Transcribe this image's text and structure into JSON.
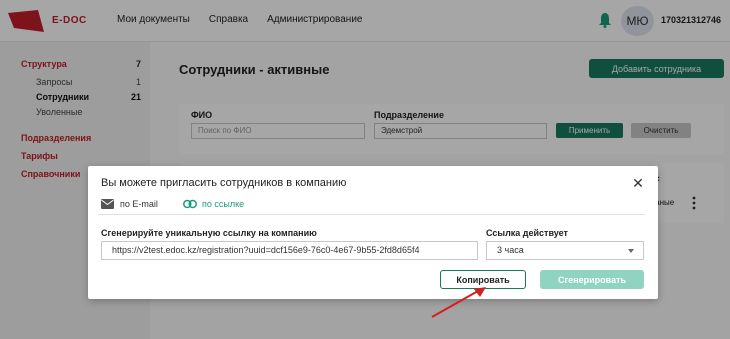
{
  "app": {
    "logo_text": "E-DOC"
  },
  "nav": {
    "items": [
      "Мои документы",
      "Справка",
      "Администрирование"
    ]
  },
  "user": {
    "initials": "МЮ",
    "id": "170321312746"
  },
  "sidebar": {
    "structure": {
      "label": "Структура",
      "count": "7"
    },
    "requests": {
      "label": "Запросы",
      "count": "1"
    },
    "employees": {
      "label": "Сотрудники",
      "count": "21"
    },
    "dismissed": {
      "label": "Уволенные"
    },
    "departments": {
      "label": "Подразделения"
    },
    "tariffs": {
      "label": "Тарифы"
    },
    "references": {
      "label": "Справочники"
    }
  },
  "page": {
    "title": "Сотрудники - активные",
    "add_button": "Добавить сотрудника"
  },
  "filters": {
    "fio_label": "ФИО",
    "fio_placeholder": "Поиск по ФИО",
    "dept_label": "Подразделение",
    "dept_value": "Эдемстрой",
    "apply": "Применить",
    "clear": "Очистить"
  },
  "table": {
    "header_fragment": "ус",
    "cell_fragment": "ваные"
  },
  "modal": {
    "title": "Вы можете пригласить сотрудников в компанию",
    "tab_email": "по E-mail",
    "tab_link": "по ссылке",
    "generate_label": "Сгенерируйте уникальную ссылку на компанию",
    "link_value": "https://v2test.edoc.kz/registration?uuid=dcf156e9-76c0-4e67-9b55-2fd8d65f4",
    "duration_label": "Ссылка действует",
    "duration_value": "3 часа",
    "copy_button": "Копировать",
    "generate_button": "Сгенерировать"
  },
  "colors": {
    "brand_red": "#c0202a",
    "accent_green": "#1a7a5e",
    "link_green": "#1a9b7a",
    "disabled_green": "#8fd3c0"
  }
}
